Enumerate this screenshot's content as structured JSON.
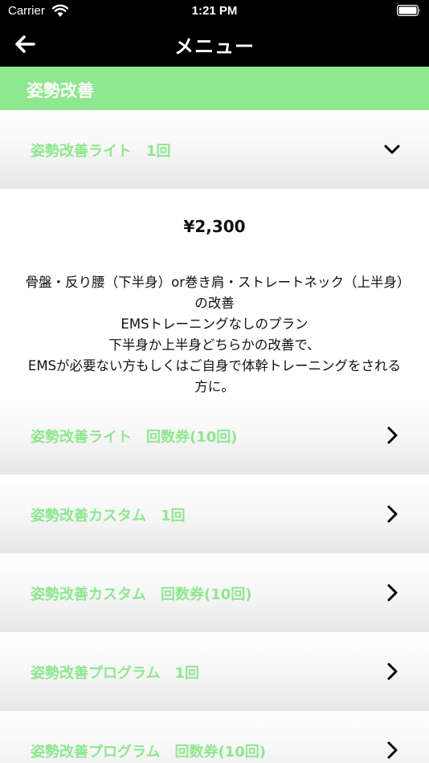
{
  "status_bar": {
    "carrier": "Carrier",
    "time": "1:21 PM"
  },
  "nav": {
    "title": "メニュー"
  },
  "section": {
    "title": "姿勢改善"
  },
  "expanded_item": {
    "label": "姿勢改善ライト　1回",
    "price": "¥2,300",
    "description": "骨盤・反り腰（下半身）or巻き肩・ストレートネック（上半身）の改善\nEMSトレーニングなしのプラン\n下半身か上半身どちらかの改善で、\nEMSが必要ない方もしくはご自身で体幹トレーニングをされる方に。"
  },
  "items": [
    {
      "label": "姿勢改善ライト　回数券(10回)"
    },
    {
      "label": "姿勢改善カスタム　1回"
    },
    {
      "label": "姿勢改善カスタム　回数券(10回)"
    },
    {
      "label": "姿勢改善プログラム　1回"
    },
    {
      "label": "姿勢改善プログラム　回数券(10回)"
    }
  ],
  "colors": {
    "accent": "#8ee88e",
    "bar": "#000000"
  },
  "icons": {
    "back": "arrow-left-icon",
    "collapse": "chevron-down-icon",
    "open": "chevron-right-icon"
  }
}
